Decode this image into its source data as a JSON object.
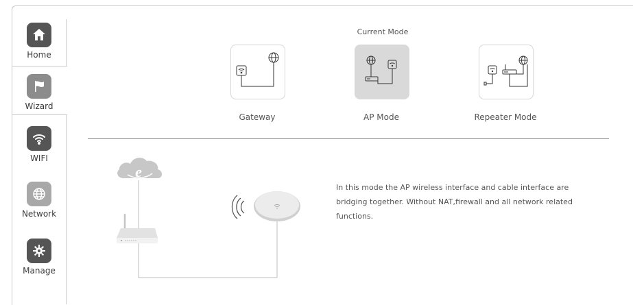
{
  "sidebar": {
    "items": [
      {
        "label": "Home",
        "icon": "home-icon"
      },
      {
        "label": "Wizard",
        "icon": "flag-icon"
      },
      {
        "label": "WIFI",
        "icon": "wifi-icon"
      },
      {
        "label": "Network",
        "icon": "globe-icon"
      },
      {
        "label": "Manage",
        "icon": "gear-icon"
      }
    ]
  },
  "wizard": {
    "current_mode_label": "Current Mode",
    "modes": [
      {
        "label": "Gateway",
        "icon": "gateway-mode-icon",
        "selected": false
      },
      {
        "label": "AP Mode",
        "icon": "ap-mode-icon",
        "selected": true
      },
      {
        "label": "Repeater Mode",
        "icon": "repeater-mode-icon",
        "selected": false
      }
    ],
    "description": "In this mode the AP wireless interface and cable interface are bridging together. Without NAT,firewall and all network related functions."
  },
  "colors": {
    "sidebar_active": "#8c8c8c",
    "sidebar_icon_dark": "#555555",
    "sidebar_icon_light": "#a8a8a8",
    "card_selected": "#d9d9d9"
  }
}
